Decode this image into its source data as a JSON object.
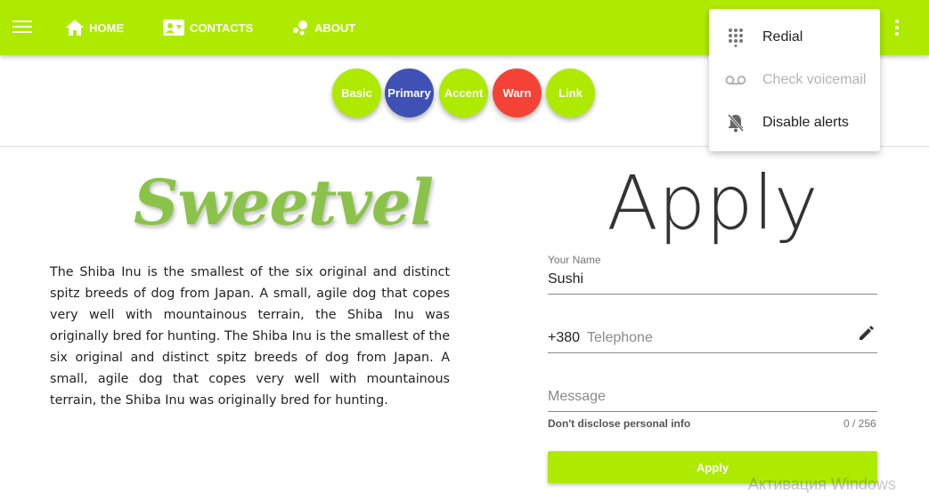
{
  "colors": {
    "accent": "#aeea00",
    "primary": "#3f51b5",
    "warn": "#f44336",
    "logo": "#8bc34a"
  },
  "toolbar": {
    "menu_icon": "hamburger-menu-icon",
    "nav": [
      {
        "label": "HOME",
        "icon": "home-icon"
      },
      {
        "label": "CONTACTS",
        "icon": "contact-card-icon"
      },
      {
        "label": "ABOUT",
        "icon": "bubbles-icon"
      }
    ],
    "more_icon": "more-vertical-icon"
  },
  "round_buttons": [
    {
      "label": "Basic",
      "color": "#aeea00"
    },
    {
      "label": "Primary",
      "color": "#3f51b5"
    },
    {
      "label": "Accent",
      "color": "#aeea00"
    },
    {
      "label": "Warn",
      "color": "#f44336"
    },
    {
      "label": "Link",
      "color": "#aeea00"
    }
  ],
  "menu": {
    "items": [
      {
        "label": "Redial",
        "icon": "dialpad-icon",
        "disabled": false
      },
      {
        "label": "Check voicemail",
        "icon": "voicemail-icon",
        "disabled": true
      },
      {
        "label": "Disable alerts",
        "icon": "notifications-off-icon",
        "disabled": false
      }
    ]
  },
  "logo": "Sweetvel",
  "paragraph": "The Shiba Inu is the smallest of the six original and distinct spitz breeds of dog from Japan. A small, agile dog that copes very well with mountainous terrain, the Shiba Inu was originally bred for hunting. The Shiba Inu is the smallest of the six original and distinct spitz breeds of dog from Japan. A small, agile dog that copes very well with mountainous terrain, the Shiba Inu was originally bred for hunting.",
  "form": {
    "title": "Apply",
    "name": {
      "label": "Your Name",
      "value": "Sushi"
    },
    "phone": {
      "prefix": "+380",
      "placeholder": "Telephone",
      "icon": "edit-icon"
    },
    "message": {
      "placeholder": "Message",
      "hint": "Don't disclose personal info",
      "counter": "0 / 256"
    },
    "submit_label": "Apply"
  },
  "watermark": "Активация Windows"
}
